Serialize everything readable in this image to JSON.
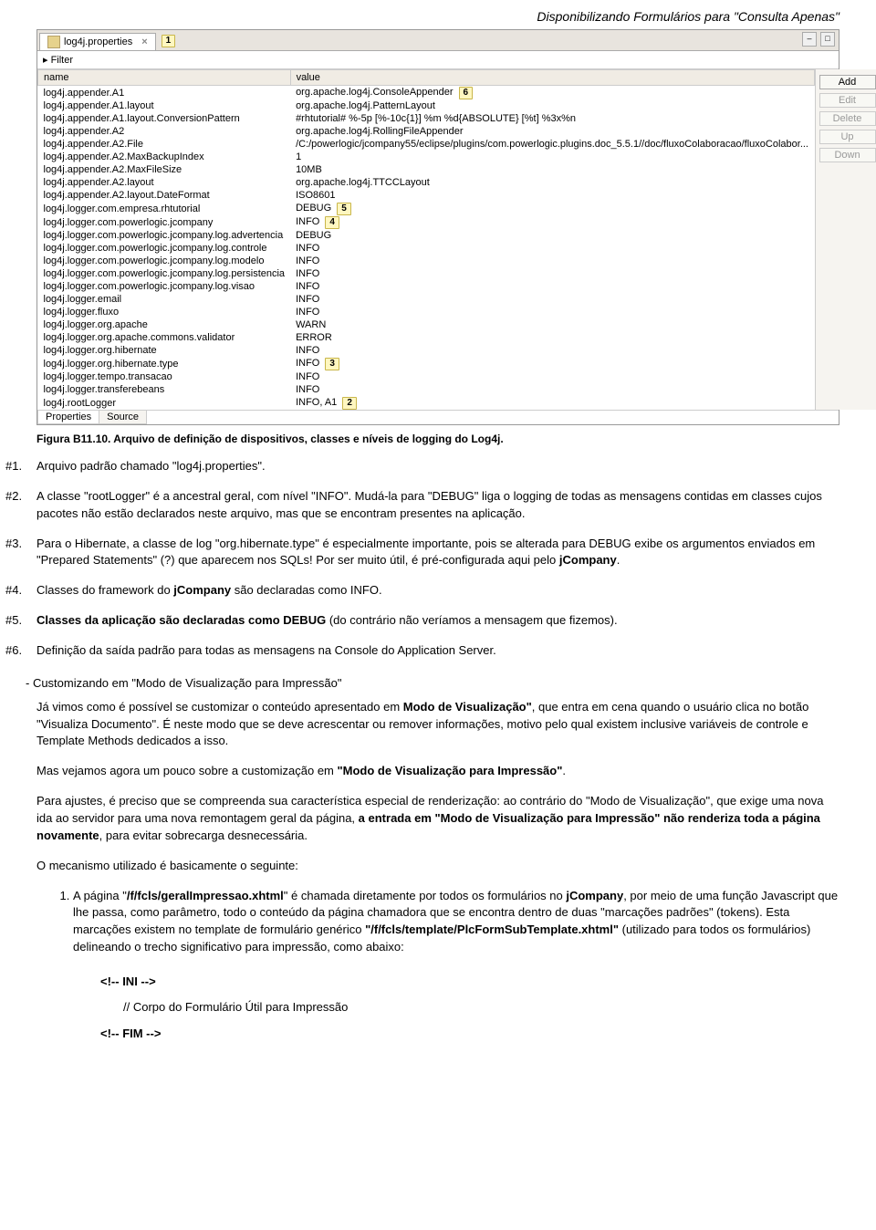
{
  "header": {
    "title": "Disponibilizando  Formulários para \"Consulta Apenas\""
  },
  "ide": {
    "tab_label": "log4j.properties",
    "tab_callout": "1",
    "filter_label": "Filter",
    "col_name": "name",
    "col_value": "value",
    "buttons": {
      "add": "Add",
      "edit": "Edit",
      "delete": "Delete",
      "up": "Up",
      "down": "Down"
    },
    "footer_tabs": {
      "properties": "Properties",
      "source": "Source"
    },
    "rows": [
      {
        "name": "log4j.appender.A1",
        "value": "org.apache.log4j.ConsoleAppender",
        "callout": "6"
      },
      {
        "name": "log4j.appender.A1.layout",
        "value": "org.apache.log4j.PatternLayout"
      },
      {
        "name": "log4j.appender.A1.layout.ConversionPattern",
        "value": "#rhtutorial# %-5p [%-10c{1}] %m %d{ABSOLUTE} [%t] %3x%n"
      },
      {
        "name": "log4j.appender.A2",
        "value": "org.apache.log4j.RollingFileAppender"
      },
      {
        "name": "log4j.appender.A2.File",
        "value": "/C:/powerlogic/jcompany55/eclipse/plugins/com.powerlogic.plugins.doc_5.5.1//doc/fluxoColaboracao/fluxoColabor..."
      },
      {
        "name": "log4j.appender.A2.MaxBackupIndex",
        "value": "1"
      },
      {
        "name": "log4j.appender.A2.MaxFileSize",
        "value": "10MB"
      },
      {
        "name": "log4j.appender.A2.layout",
        "value": "org.apache.log4j.TTCCLayout"
      },
      {
        "name": "log4j.appender.A2.layout.DateFormat",
        "value": "ISO8601"
      },
      {
        "name": "log4j.logger.com.empresa.rhtutorial",
        "value": "DEBUG",
        "callout": "5"
      },
      {
        "name": "log4j.logger.com.powerlogic.jcompany",
        "value": "INFO",
        "callout": "4"
      },
      {
        "name": "log4j.logger.com.powerlogic.jcompany.log.advertencia",
        "value": "DEBUG"
      },
      {
        "name": "log4j.logger.com.powerlogic.jcompany.log.controle",
        "value": "INFO"
      },
      {
        "name": "log4j.logger.com.powerlogic.jcompany.log.modelo",
        "value": "INFO"
      },
      {
        "name": "log4j.logger.com.powerlogic.jcompany.log.persistencia",
        "value": "INFO"
      },
      {
        "name": "log4j.logger.com.powerlogic.jcompany.log.visao",
        "value": "INFO"
      },
      {
        "name": "log4j.logger.email",
        "value": "INFO"
      },
      {
        "name": "log4j.logger.fluxo",
        "value": "INFO"
      },
      {
        "name": "log4j.logger.org.apache",
        "value": "WARN"
      },
      {
        "name": "log4j.logger.org.apache.commons.validator",
        "value": "ERROR"
      },
      {
        "name": "log4j.logger.org.hibernate",
        "value": "INFO"
      },
      {
        "name": "log4j.logger.org.hibernate.type",
        "value": "INFO",
        "callout": "3"
      },
      {
        "name": "log4j.logger.tempo.transacao",
        "value": "INFO"
      },
      {
        "name": "log4j.logger.transferebeans",
        "value": "INFO"
      },
      {
        "name": "log4j.rootLogger",
        "value": "INFO, A1",
        "callout": "2"
      }
    ]
  },
  "caption": "Figura B11.10. Arquivo de definição de dispositivos, classes e níveis de logging do Log4j.",
  "items": {
    "n1_num": "#1.",
    "n1": "Arquivo padrão chamado \"log4j.properties\".",
    "n2_num": "#2.",
    "n2_a": "A classe \"rootLogger\" é a ancestral geral, com nível \"INFO\". Mudá-la para \"DEBUG\" liga o logging de todas as mensagens contidas em classes cujos pacotes não estão declarados neste arquivo, mas que se encontram presentes na aplicação.",
    "n3_num": "#3.",
    "n3_a": "Para o Hibernate, a classe de log \"org.hibernate.type\" é especialmente importante, pois se alterada para DEBUG exibe os argumentos enviados em \"Prepared Statements\" (?) que aparecem nos SQLs! Por ser muito útil, é pré-configurada aqui pelo ",
    "n3_b": "jCompany",
    "n3_c": ".",
    "n4_num": "#4.",
    "n4_a": "Classes do framework do ",
    "n4_b": "jCompany",
    "n4_c": " são declaradas como INFO.",
    "n5_num": "#5.",
    "n5_a": "Classes da aplicação são declaradas como DEBUG",
    "n5_b": " (do contrário não veríamos a mensagem que fizemos).",
    "n6_num": "#6.",
    "n6": "Definição da saída padrão para todas as mensagens na Console do Application Server."
  },
  "section": {
    "title": "- Customizando em \"Modo de Visualização para Impressão\"",
    "p1_a": "Já vimos como é possível se customizar o conteúdo apresentado em ",
    "p1_b": "Modo de Visualização\"",
    "p1_c": ", que entra em cena quando o usuário clica no botão \"Visualiza Documento\". É neste modo que se deve acrescentar ou remover informações, motivo pelo qual existem inclusive variáveis de controle e Template Methods dedicados a isso.",
    "p2_a": "Mas vejamos agora um pouco sobre a customização em ",
    "p2_b": "\"Modo de Visualização para Impressão\"",
    "p2_c": ".",
    "p3_a": "Para ajustes, é preciso que se compreenda sua característica especial de renderização: ao contrário do \"Modo de Visualização\", que exige uma nova ida ao servidor para uma nova remontagem geral da página, ",
    "p3_b": "a entrada em \"Modo de Visualização para Impressão\" não renderiza toda a página novamente",
    "p3_c": ", para evitar sobrecarga desnecessária.",
    "p4": "O mecanismo utilizado é basicamente o seguinte:",
    "li1_num": "1.",
    "li1_a": "A página \"",
    "li1_b": "/f/fcls/geralImpressao.xhtml",
    "li1_c": "\" é chamada diretamente por todos os formulários no ",
    "li1_d": "jCompany",
    "li1_e": ", por meio de uma função Javascript que lhe passa, como parâmetro, todo o conteúdo da página chamadora que se encontra dentro de duas \"marcações padrões\" (tokens). Esta marcações existem no template de formulário genérico ",
    "li1_f": "\"/f/fcls/template/PlcFormSubTemplate.xhtml\"",
    "li1_g": " (utilizado para todos os formulários)  delineando o trecho significativo para impressão, como abaixo:"
  },
  "code": {
    "ini": "<!-- INI -->",
    "body": "// Corpo do Formulário Útil para Impressão",
    "fim": "<!-- FIM -->"
  }
}
